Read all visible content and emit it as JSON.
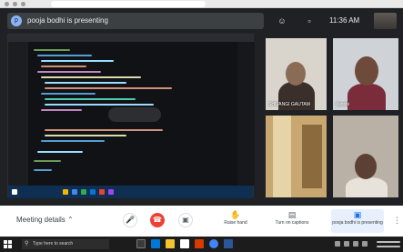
{
  "presenting": {
    "avatar_letter": "p",
    "text": "pooja bodhi is presenting"
  },
  "header": {
    "people_icon": "people-icon",
    "chat_icon": "chat-icon",
    "time": "11:36 AM"
  },
  "participants": [
    {
      "name": "SHIVANGI GAUTAM"
    },
    {
      "name": "Vanshi"
    },
    {
      "name": ""
    },
    {
      "name": ""
    }
  ],
  "controls": {
    "meeting_details": "Meeting details",
    "mic_icon": "microphone-icon",
    "end_call_icon": "hang-up-icon",
    "camera_icon": "camera-icon",
    "raise_hand_label": "Raise hand",
    "captions_label": "Turn on captions",
    "presenting_label": "pooja bodhi is presenting",
    "more_icon": "more-options-icon"
  },
  "taskbar": {
    "search_placeholder": "Type here to search"
  },
  "colors": {
    "meet_background": "#202124",
    "end_call_red": "#ea4335",
    "taskbar": "#1c1c1c"
  }
}
